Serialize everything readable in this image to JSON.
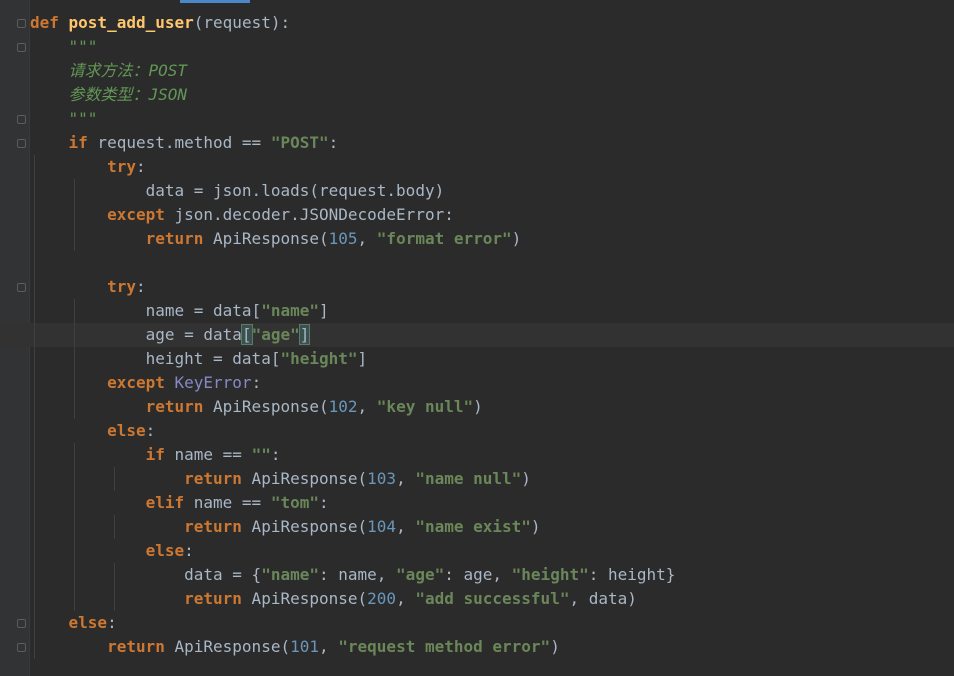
{
  "editor": {
    "language": "python",
    "colors": {
      "background": "#2b2b2b",
      "keyword": "#cc7832",
      "function": "#ffc66d",
      "string": "#6a8759",
      "number": "#6897bb",
      "docstring": "#629755",
      "default": "#a9b7c6"
    },
    "current_line": 14,
    "lines": [
      [
        {
          "t": "def ",
          "k": "kw"
        },
        {
          "t": "post_add_user",
          "k": "fn"
        },
        {
          "t": "(",
          "k": "p"
        },
        {
          "t": "request",
          "k": "param"
        },
        {
          "t": "):",
          "k": "p"
        }
      ],
      [
        {
          "t": "    \"\"\"",
          "k": "doc"
        }
      ],
      [
        {
          "t": "    请求方法：POST",
          "k": "doc"
        }
      ],
      [
        {
          "t": "    参数类型：JSON",
          "k": "doc"
        }
      ],
      [
        {
          "t": "    \"\"\"",
          "k": "doc"
        }
      ],
      [
        {
          "t": "    ",
          "k": "p"
        },
        {
          "t": "if",
          "k": "kw"
        },
        {
          "t": " request.method == ",
          "k": "p"
        },
        {
          "t": "\"POST\"",
          "k": "str"
        },
        {
          "t": ":",
          "k": "p"
        }
      ],
      [
        {
          "t": "        ",
          "k": "p"
        },
        {
          "t": "try",
          "k": "kw"
        },
        {
          "t": ":",
          "k": "p"
        }
      ],
      [
        {
          "t": "            data = json.loads(request.body)",
          "k": "p"
        }
      ],
      [
        {
          "t": "        ",
          "k": "p"
        },
        {
          "t": "except",
          "k": "kw"
        },
        {
          "t": " json.decoder.JSONDecodeError:",
          "k": "p"
        }
      ],
      [
        {
          "t": "            ",
          "k": "p"
        },
        {
          "t": "return",
          "k": "kw"
        },
        {
          "t": " ApiResponse(",
          "k": "p"
        },
        {
          "t": "105",
          "k": "num"
        },
        {
          "t": ", ",
          "k": "p"
        },
        {
          "t": "\"format error\"",
          "k": "str"
        },
        {
          "t": ")",
          "k": "p"
        }
      ],
      [],
      [
        {
          "t": "        ",
          "k": "p"
        },
        {
          "t": "try",
          "k": "kw"
        },
        {
          "t": ":",
          "k": "p"
        }
      ],
      [
        {
          "t": "            name = data[",
          "k": "p"
        },
        {
          "t": "\"name\"",
          "k": "str"
        },
        {
          "t": "]",
          "k": "p"
        }
      ],
      [
        {
          "t": "            age = data",
          "k": "p"
        },
        {
          "t": "[",
          "k": "match"
        },
        {
          "t": "\"age\"",
          "k": "str"
        },
        {
          "t": "]",
          "k": "match"
        }
      ],
      [
        {
          "t": "            height = data[",
          "k": "p"
        },
        {
          "t": "\"height\"",
          "k": "str"
        },
        {
          "t": "]",
          "k": "p"
        }
      ],
      [
        {
          "t": "        ",
          "k": "p"
        },
        {
          "t": "except",
          "k": "kw"
        },
        {
          "t": " ",
          "k": "p"
        },
        {
          "t": "KeyError",
          "k": "exc"
        },
        {
          "t": ":",
          "k": "p"
        }
      ],
      [
        {
          "t": "            ",
          "k": "p"
        },
        {
          "t": "return",
          "k": "kw"
        },
        {
          "t": " ApiResponse(",
          "k": "p"
        },
        {
          "t": "102",
          "k": "num"
        },
        {
          "t": ", ",
          "k": "p"
        },
        {
          "t": "\"key null\"",
          "k": "str"
        },
        {
          "t": ")",
          "k": "p"
        }
      ],
      [
        {
          "t": "        ",
          "k": "p"
        },
        {
          "t": "else",
          "k": "kw"
        },
        {
          "t": ":",
          "k": "p"
        }
      ],
      [
        {
          "t": "            ",
          "k": "p"
        },
        {
          "t": "if",
          "k": "kw"
        },
        {
          "t": " name == ",
          "k": "p"
        },
        {
          "t": "\"\"",
          "k": "str"
        },
        {
          "t": ":",
          "k": "p"
        }
      ],
      [
        {
          "t": "                ",
          "k": "p"
        },
        {
          "t": "return",
          "k": "kw"
        },
        {
          "t": " ApiResponse(",
          "k": "p"
        },
        {
          "t": "103",
          "k": "num"
        },
        {
          "t": ", ",
          "k": "p"
        },
        {
          "t": "\"name null\"",
          "k": "str"
        },
        {
          "t": ")",
          "k": "p"
        }
      ],
      [
        {
          "t": "            ",
          "k": "p"
        },
        {
          "t": "elif",
          "k": "kw"
        },
        {
          "t": " name == ",
          "k": "p"
        },
        {
          "t": "\"tom\"",
          "k": "str"
        },
        {
          "t": ":",
          "k": "p"
        }
      ],
      [
        {
          "t": "                ",
          "k": "p"
        },
        {
          "t": "return",
          "k": "kw"
        },
        {
          "t": " ApiResponse(",
          "k": "p"
        },
        {
          "t": "104",
          "k": "num"
        },
        {
          "t": ", ",
          "k": "p"
        },
        {
          "t": "\"name exist\"",
          "k": "str"
        },
        {
          "t": ")",
          "k": "p"
        }
      ],
      [
        {
          "t": "            ",
          "k": "p"
        },
        {
          "t": "else",
          "k": "kw"
        },
        {
          "t": ":",
          "k": "p"
        }
      ],
      [
        {
          "t": "                data = {",
          "k": "p"
        },
        {
          "t": "\"name\"",
          "k": "str"
        },
        {
          "t": ": name, ",
          "k": "p"
        },
        {
          "t": "\"age\"",
          "k": "str"
        },
        {
          "t": ": age, ",
          "k": "p"
        },
        {
          "t": "\"height\"",
          "k": "str"
        },
        {
          "t": ": height}",
          "k": "p"
        }
      ],
      [
        {
          "t": "                ",
          "k": "p"
        },
        {
          "t": "return",
          "k": "kw"
        },
        {
          "t": " ApiResponse(",
          "k": "p"
        },
        {
          "t": "200",
          "k": "num"
        },
        {
          "t": ", ",
          "k": "p"
        },
        {
          "t": "\"add successful\"",
          "k": "str"
        },
        {
          "t": ", data)",
          "k": "p"
        }
      ],
      [
        {
          "t": "    ",
          "k": "p"
        },
        {
          "t": "else",
          "k": "kw"
        },
        {
          "t": ":",
          "k": "p"
        }
      ],
      [
        {
          "t": "        ",
          "k": "p"
        },
        {
          "t": "return",
          "k": "kw"
        },
        {
          "t": " ApiResponse(",
          "k": "p"
        },
        {
          "t": "101",
          "k": "num"
        },
        {
          "t": ", ",
          "k": "p"
        },
        {
          "t": "\"request method error\"",
          "k": "str"
        },
        {
          "t": ")",
          "k": "p"
        }
      ]
    ]
  }
}
